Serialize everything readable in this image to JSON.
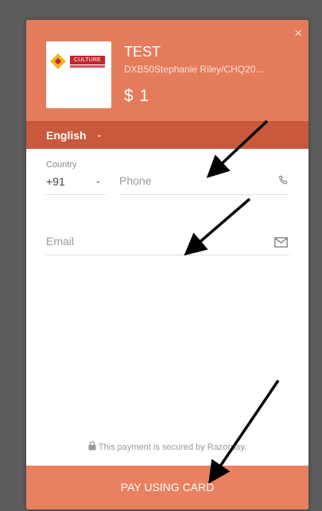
{
  "header": {
    "close_glyph": "×",
    "title": "TEST",
    "description": "DXB50Stephanie Riley/CHQ20...",
    "amount": "$ 1",
    "color": "#e47b5b"
  },
  "logo": {
    "text": "CULTURE"
  },
  "language": {
    "selected": "English"
  },
  "form": {
    "country_label": "Country",
    "country_code": "+91",
    "phone_placeholder": "Phone",
    "email_placeholder": "Email"
  },
  "footer": {
    "secure_text": "This payment is secured by Razorpay.",
    "pay_label": "PAY USING CARD"
  },
  "icons": {
    "close": "close-icon",
    "language_dropdown": "chevron-down-icon",
    "country_dropdown": "chevron-down-icon",
    "phone": "phone-icon",
    "email": "mail-icon",
    "secure": "lock-icon"
  },
  "colors": {
    "header": "#e47b5b",
    "language_bar": "#c9583c",
    "pay_button": "#e9805f",
    "overlay": "#5c5c5c"
  }
}
